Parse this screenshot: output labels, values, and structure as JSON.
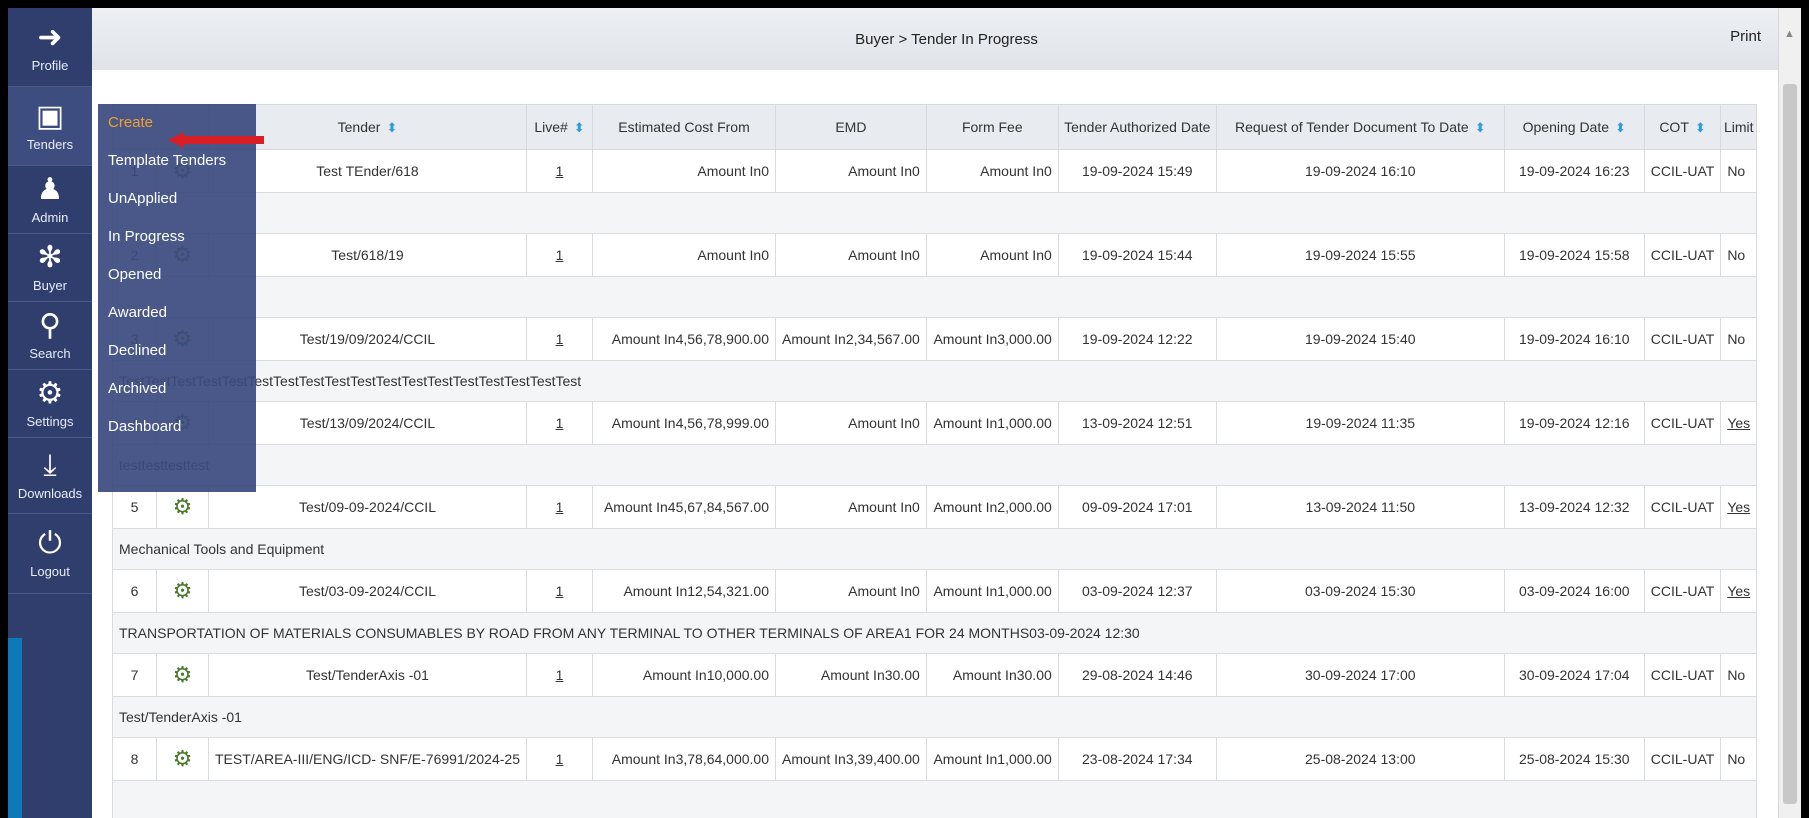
{
  "sidebar": {
    "items": [
      {
        "label": "Profile",
        "icon": "profile-icon"
      },
      {
        "label": "Tenders",
        "icon": "tenders-icon"
      },
      {
        "label": "Admin",
        "icon": "admin-icon"
      },
      {
        "label": "Buyer",
        "icon": "buyer-icon"
      },
      {
        "label": "Search",
        "icon": "search-icon"
      },
      {
        "label": "Settings",
        "icon": "settings-icon"
      },
      {
        "label": "Downloads",
        "icon": "download-icon"
      },
      {
        "label": "Logout",
        "icon": "logout-icon"
      }
    ]
  },
  "header": {
    "breadcrumb": "Buyer > Tender In Progress",
    "print": "Print"
  },
  "submenu": {
    "items": [
      "Create",
      "Template Tenders",
      "UnApplied",
      "In Progress",
      "Opened",
      "Awarded",
      "Declined",
      "Archived",
      "Dashboard"
    ]
  },
  "table": {
    "columns": [
      "",
      "",
      "Tender",
      "Live#",
      "Estimated Cost From",
      "EMD",
      "Form Fee",
      "Tender Authorized Date",
      "Request of Tender Document To Date",
      "Opening Date",
      "COT",
      "Limit"
    ],
    "rows": [
      {
        "no": "1",
        "tender": "Test TEnder/618",
        "live": "1",
        "cost": "Amount In0",
        "emd": "Amount In0",
        "fee": "Amount In0",
        "auth": "19-09-2024 15:49",
        "req": "19-09-2024 16:10",
        "open": "19-09-2024 16:23",
        "cot": "CCIL-UAT",
        "limit": "No",
        "desc": ""
      },
      {
        "no": "2",
        "tender": "Test/618/19",
        "live": "1",
        "cost": "Amount In0",
        "emd": "Amount In0",
        "fee": "Amount In0",
        "auth": "19-09-2024 15:44",
        "req": "19-09-2024 15:55",
        "open": "19-09-2024 15:58",
        "cot": "CCIL-UAT",
        "limit": "No",
        "desc": ""
      },
      {
        "no": "3",
        "tender": "Test/19/09/2024/CCIL",
        "live": "1",
        "cost": "Amount In4,56,78,900.00",
        "emd": "Amount In2,34,567.00",
        "fee": "Amount In3,000.00",
        "auth": "19-09-2024 12:22",
        "req": "19-09-2024 15:40",
        "open": "19-09-2024 16:10",
        "cot": "CCIL-UAT",
        "limit": "No",
        "desc": "TestTestTestTestTestTestTestTestTestTestTestTestTestTestTestTestTestTest"
      },
      {
        "no": "4",
        "tender": "Test/13/09/2024/CCIL",
        "live": "1",
        "cost": "Amount In4,56,78,999.00",
        "emd": "Amount In0",
        "fee": "Amount In1,000.00",
        "auth": "13-09-2024 12:51",
        "req": "19-09-2024 11:35",
        "open": "19-09-2024 12:16",
        "cot": "CCIL-UAT",
        "limit": "Yes",
        "desc": "testtesttesttest"
      },
      {
        "no": "5",
        "tender": "Test/09-09-2024/CCIL",
        "live": "1",
        "cost": "Amount In45,67,84,567.00",
        "emd": "Amount In0",
        "fee": "Amount In2,000.00",
        "auth": "09-09-2024 17:01",
        "req": "13-09-2024 11:50",
        "open": "13-09-2024 12:32",
        "cot": "CCIL-UAT",
        "limit": "Yes",
        "desc": "Mechanical Tools and Equipment"
      },
      {
        "no": "6",
        "tender": "Test/03-09-2024/CCIL",
        "live": "1",
        "cost": "Amount In12,54,321.00",
        "emd": "Amount In0",
        "fee": "Amount In1,000.00",
        "auth": "03-09-2024 12:37",
        "req": "03-09-2024 15:30",
        "open": "03-09-2024 16:00",
        "cot": "CCIL-UAT",
        "limit": "Yes",
        "desc": "TRANSPORTATION OF MATERIALS CONSUMABLES BY ROAD FROM ANY TERMINAL TO OTHER TERMINALS OF AREA1 FOR 24 MONTHS03-09-2024 12:30"
      },
      {
        "no": "7",
        "tender": "Test/TenderAxis -01",
        "live": "1",
        "cost": "Amount In10,000.00",
        "emd": "Amount In30.00",
        "fee": "Amount In30.00",
        "auth": "29-08-2024 14:46",
        "req": "30-09-2024 17:00",
        "open": "30-09-2024 17:04",
        "cot": "CCIL-UAT",
        "limit": "No",
        "desc": "Test/TenderAxis -01"
      },
      {
        "no": "8",
        "tender": "TEST/AREA-III/ENG/ICD- SNF/E-76991/2024-25",
        "live": "1",
        "cost": "Amount In3,78,64,000.00",
        "emd": "Amount In3,39,400.00",
        "fee": "Amount In1,000.00",
        "auth": "23-08-2024 17:34",
        "req": "25-08-2024 13:00",
        "open": "25-08-2024 15:30",
        "cot": "CCIL-UAT",
        "limit": "No",
        "desc": ""
      }
    ]
  }
}
